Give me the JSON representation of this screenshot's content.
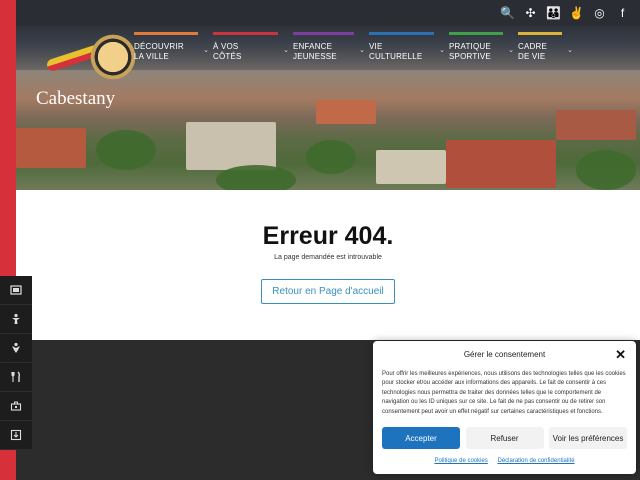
{
  "site": {
    "name": "Cabestany"
  },
  "top_icons": [
    {
      "name": "search-icon",
      "glyph": "🔍"
    },
    {
      "name": "sitemap-icon",
      "glyph": "✣"
    },
    {
      "name": "family-icon",
      "glyph": "👪"
    },
    {
      "name": "accessibility-icon",
      "glyph": "✌"
    },
    {
      "name": "instagram-icon",
      "glyph": "◎"
    },
    {
      "name": "facebook-icon",
      "glyph": "f"
    }
  ],
  "nav": [
    {
      "id": "decouvrir",
      "line1": "Découvrir",
      "line2": "la ville",
      "color": "#e07b39"
    },
    {
      "id": "avos",
      "line1": "À vos",
      "line2": "côtés",
      "color": "#c8343f"
    },
    {
      "id": "enfance",
      "line1": "Enfance",
      "line2": "Jeunesse",
      "color": "#7b3fa0"
    },
    {
      "id": "culture",
      "line1": "Vie",
      "line2": "culturelle",
      "color": "#2b6fb5"
    },
    {
      "id": "sport",
      "line1": "Pratique",
      "line2": "sportive",
      "color": "#3fa04a"
    },
    {
      "id": "cadre",
      "line1": "Cadre",
      "line2": "de vie",
      "color": "#d9b33a"
    }
  ],
  "error": {
    "title": "Erreur 404.",
    "subtitle": "La page demandée est introuvable",
    "button": "Retour en Page d'accueil"
  },
  "dock": [
    {
      "name": "film-icon"
    },
    {
      "name": "person-icon"
    },
    {
      "name": "baby-icon"
    },
    {
      "name": "restaurant-icon"
    },
    {
      "name": "briefcase-icon"
    },
    {
      "name": "download-icon"
    }
  ],
  "consent": {
    "title": "Gérer le consentement",
    "text": "Pour offrir les meilleures expériences, nous utilisons des technologies telles que les cookies pour stocker et/ou accéder aux informations des appareils. Le fait de consentir à ces technologies nous permettra de traiter des données telles que le comportement de navigation ou les ID uniques sur ce site. Le fait de ne pas consentir ou de retirer son consentement peut avoir un effet négatif sur certaines caractéristiques et fonctions.",
    "accept": "Accepter",
    "refuse": "Refuser",
    "prefs": "Voir les préférences",
    "link_cookies": "Politique de cookies",
    "link_privacy": "Déclaration de confidentialité"
  },
  "colors": {
    "accent": "#1e73be",
    "brand_red": "#d6303b",
    "link_blue": "#3a8fbf"
  }
}
